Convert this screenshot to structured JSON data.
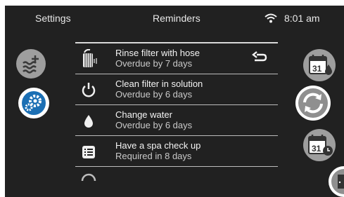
{
  "header": {
    "left": "Settings",
    "title": "Reminders",
    "time": "8:01 am"
  },
  "reminders": [
    {
      "title": "Rinse filter with hose",
      "status": "Overdue by 7 days",
      "icon": "filter-hose-icon"
    },
    {
      "title": "Clean filter in solution",
      "status": "Overdue by 6 days",
      "icon": "power-icon"
    },
    {
      "title": "Change water",
      "status": "Overdue by 6 days",
      "icon": "water-drop-icon"
    },
    {
      "title": "Have a spa check up",
      "status": "Required in 8 days",
      "icon": "checklist-icon"
    }
  ],
  "side_buttons": {
    "calendar_day": "31",
    "calendar_day_2": "31"
  },
  "colors": {
    "background": "#212121",
    "accent_blue": "#1b6fb4",
    "gray_button": "#9e9e9e"
  }
}
